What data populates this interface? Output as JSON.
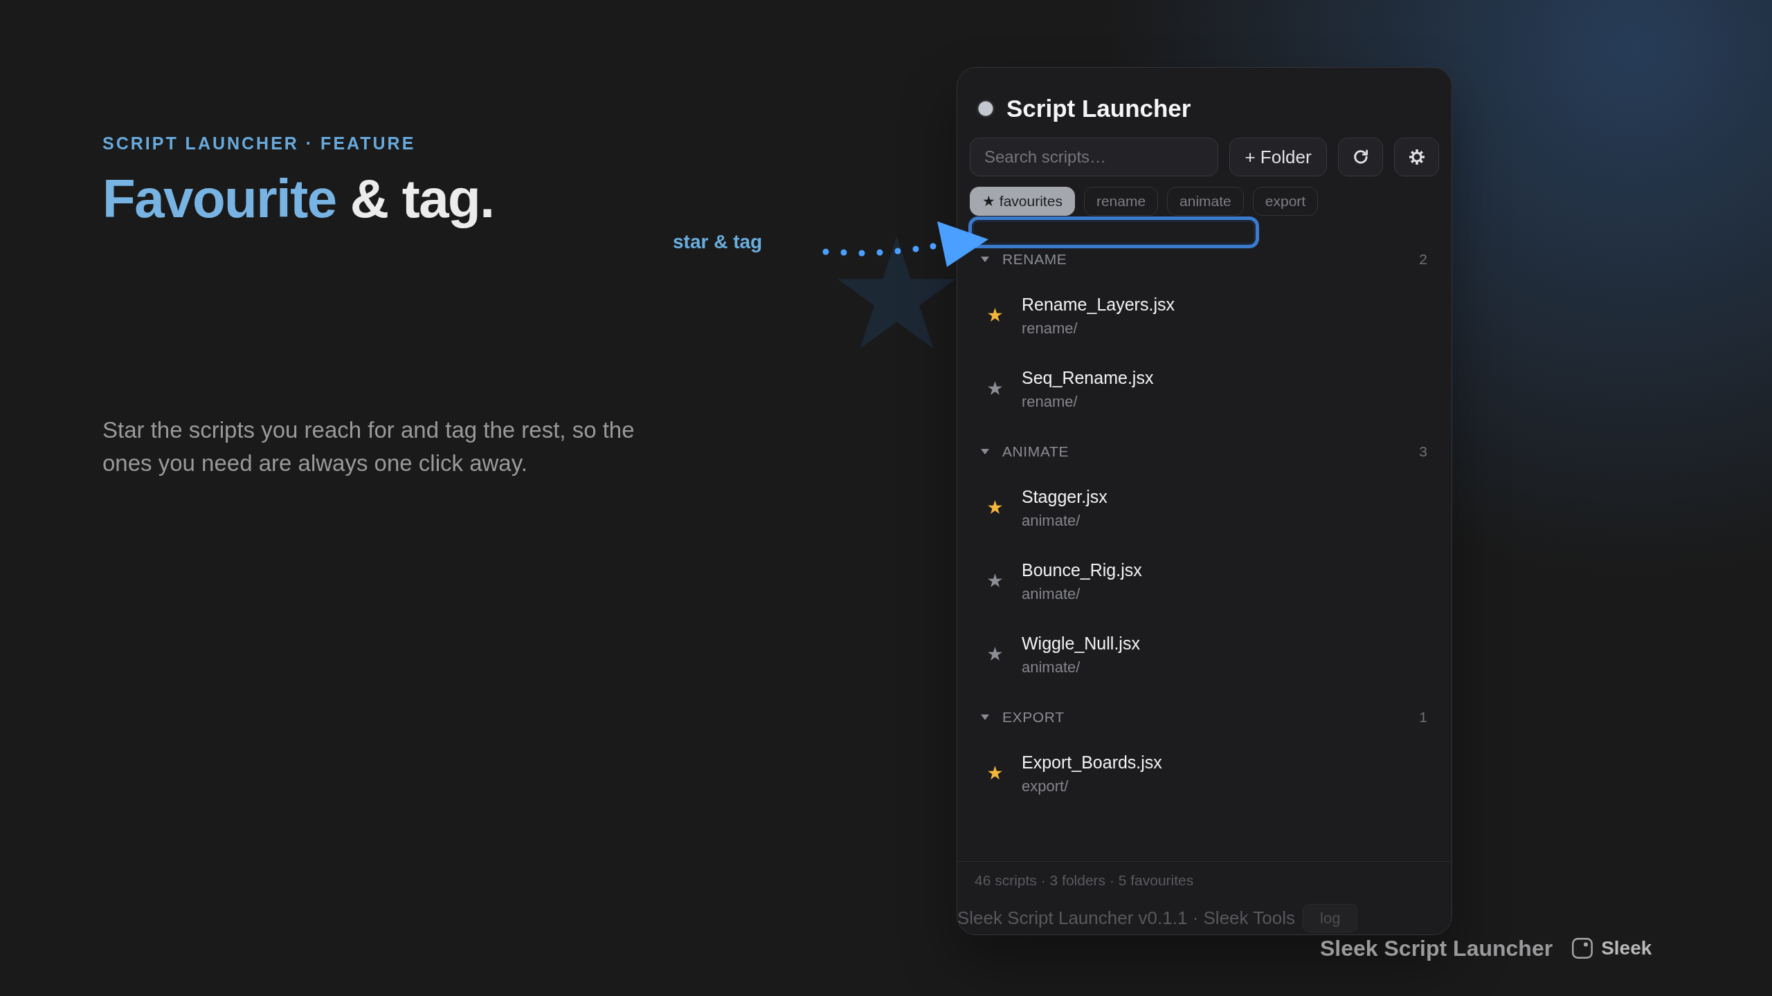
{
  "hero": {
    "eyebrow": "SCRIPT LAUNCHER · FEATURE",
    "heading_accent": "Favourite",
    "heading_rest": "& tag.",
    "body": "Star the scripts you reach for and tag the rest, so the ones you need are always one click away."
  },
  "callout": {
    "label": "star & tag"
  },
  "panel": {
    "title": "Script Launcher",
    "search": {
      "placeholder": "Search scripts…"
    },
    "buttons": [
      {
        "kind": "add",
        "label": "+ Folder"
      },
      {
        "kind": "refresh"
      },
      {
        "kind": "settings"
      }
    ],
    "tags": [
      {
        "label": "★ favourites",
        "selected": true
      },
      {
        "label": "rename",
        "selected": false
      },
      {
        "label": "animate",
        "selected": false
      },
      {
        "label": "export",
        "selected": false
      }
    ],
    "groups": [
      {
        "name": "RENAME",
        "count": "2",
        "expanded": true,
        "items": [
          {
            "name": "Rename_Layers.jsx",
            "path": "rename/",
            "favourite": true
          },
          {
            "name": "Seq_Rename.jsx",
            "path": "rename/",
            "favourite": false
          }
        ]
      },
      {
        "name": "ANIMATE",
        "count": "3",
        "expanded": true,
        "items": [
          {
            "name": "Stagger.jsx",
            "path": "animate/",
            "favourite": true
          },
          {
            "name": "Bounce_Rig.jsx",
            "path": "animate/",
            "favourite": false
          },
          {
            "name": "Wiggle_Null.jsx",
            "path": "animate/",
            "favourite": false
          }
        ]
      },
      {
        "name": "EXPORT",
        "count": "1",
        "expanded": true,
        "items": [
          {
            "name": "Export_Boards.jsx",
            "path": "export/",
            "favourite": true
          }
        ]
      }
    ],
    "status": "46 scripts · 3 folders · 5 favourites",
    "footer": {
      "text": "Sleek Script Launcher v0.1.1 · Sleek Tools",
      "button": "log"
    }
  },
  "brand": {
    "product": "Sleek Script Launcher",
    "name": "Sleek"
  }
}
